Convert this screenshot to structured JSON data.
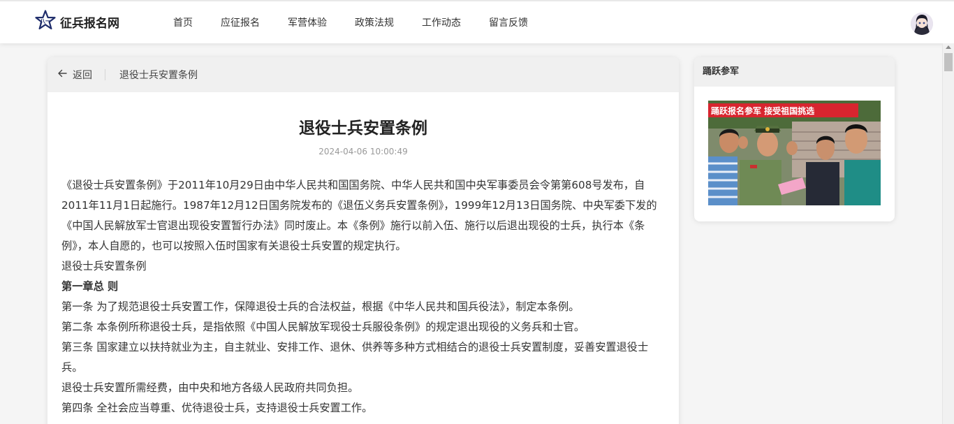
{
  "brand": {
    "name": "征兵报名网",
    "logo_icon": "star-logo-icon",
    "logo_color": "#1f2d6b"
  },
  "nav": {
    "items": [
      "首页",
      "应征报名",
      "军营体验",
      "政策法规",
      "工作动态",
      "留言反馈"
    ]
  },
  "user": {
    "avatar_icon": "user-avatar"
  },
  "breadcrumb": {
    "back_label": "返回",
    "current": "退役士兵安置条例"
  },
  "article": {
    "title": "退役士兵安置条例",
    "date": "2024-04-06 10:00:49",
    "paragraphs": [
      "《退役士兵安置条例》于2011年10月29日由中华人民共和国国务院、中华人民共和国中央军事委员会令第第608号发布，自2011年11月1日起施行。1987年12月12日国务院发布的《退伍义务兵安置条例》，1999年12月13日国务院、中央军委下发的《中国人民解放军士官退出现役安置暂行办法》同时废止。本《条例》施行以前入伍、施行以后退出现役的士兵，执行本《条例》，本人自愿的，也可以按照入伍时国家有关退役士兵安置的规定执行。",
      "退役士兵安置条例",
      "第一章总 则",
      "第一条 为了规范退役士兵安置工作，保障退役士兵的合法权益，根据《中华人民共和国兵役法》，制定本条例。",
      "第二条 本条例所称退役士兵，是指依照《中国人民解放军现役士兵服役条例》的规定退出现役的义务兵和士官。",
      "第三条 国家建立以扶持就业为主，自主就业、安排工作、退休、供养等多种方式相结合的退役士兵安置制度，妥善安置退役士兵。",
      "退役士兵安置所需经费，由中央和地方各级人民政府共同负担。",
      "第四条 全社会应当尊重、优待退役士兵，支持退役士兵安置工作。"
    ]
  },
  "sidebar": {
    "heading": "踊跃参军",
    "banner_text": "踊跃报名参军  接受祖国挑选",
    "banner_color": "#d8252f"
  }
}
